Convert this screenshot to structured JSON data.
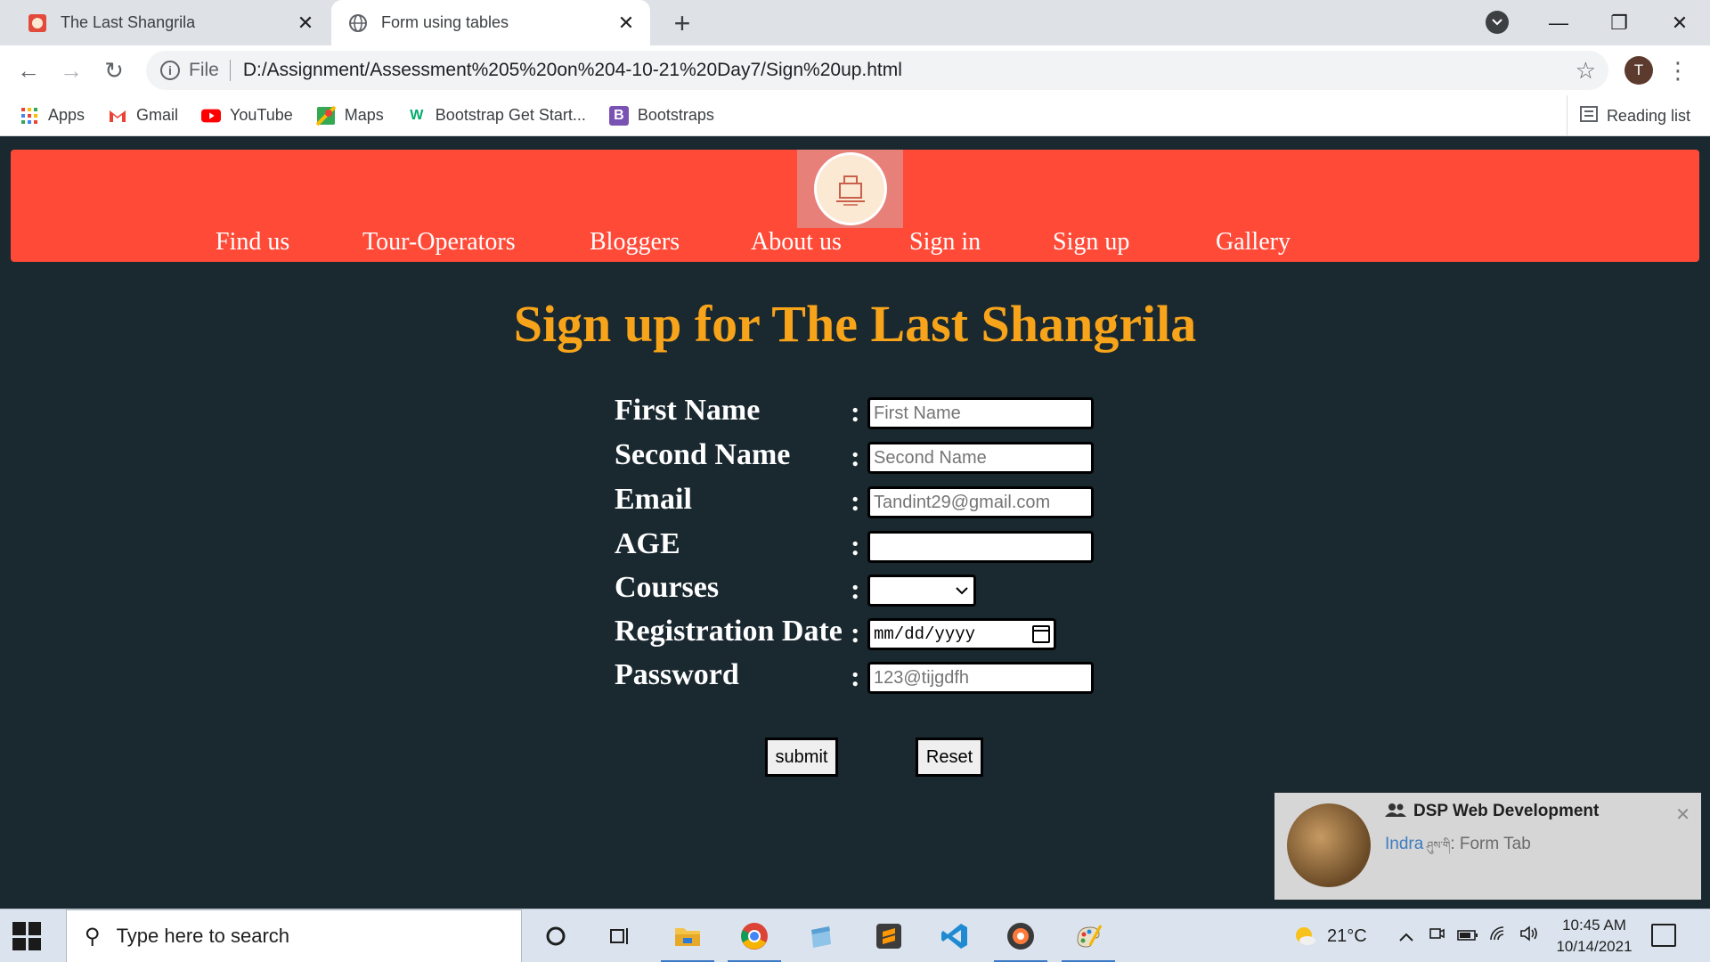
{
  "browser": {
    "tabs": [
      {
        "title": "The Last Shangrila",
        "active": false
      },
      {
        "title": "Form using tables",
        "active": true
      }
    ],
    "address": {
      "scheme": "File",
      "url": "D:/Assignment/Assessment%205%20on%204-10-21%20Day7/Sign%20up.html"
    },
    "profile_initial": "T",
    "bookmarks": [
      {
        "label": "Apps",
        "icon": "apps-grid-icon"
      },
      {
        "label": "Gmail",
        "icon": "gmail-icon"
      },
      {
        "label": "YouTube",
        "icon": "youtube-icon"
      },
      {
        "label": "Maps",
        "icon": "maps-icon"
      },
      {
        "label": "Bootstrap Get Start...",
        "icon": "w3schools-icon"
      },
      {
        "label": "Bootstraps",
        "icon": "bootstrap-icon"
      }
    ],
    "reading_list": "Reading list"
  },
  "page": {
    "nav": [
      "Find us",
      "Tour-Operators",
      "Bloggers",
      "About us",
      "Sign in",
      "Sign up",
      "Gallery"
    ],
    "title": "Sign up for The Last Shangrila",
    "form": {
      "first_name": {
        "label": "First Name",
        "placeholder": "First Name"
      },
      "second_name": {
        "label": "Second Name",
        "placeholder": "Second Name"
      },
      "email": {
        "label": "Email",
        "placeholder": "Tandint29@gmail.com"
      },
      "age": {
        "label": "AGE"
      },
      "courses": {
        "label": "Courses"
      },
      "registration_date": {
        "label": "Registration Date",
        "placeholder": "mm/dd/yyyy"
      },
      "password": {
        "label": "Password",
        "placeholder": "123@tijgdfh"
      },
      "colon": ":",
      "submit_label": "submit",
      "reset_label": "Reset"
    }
  },
  "notification": {
    "group": "DSP Web Development",
    "sender": "Indra",
    "sender_suffix": " ཤུས་གི",
    "message": ": Form Tab"
  },
  "taskbar": {
    "search_placeholder": "Type here to search",
    "weather": "21°C",
    "time": "10:45 AM",
    "date": "10/14/2021"
  },
  "colors": {
    "header_red": "#ff4a38",
    "page_bg": "#1a2830",
    "title_orange": "#f7a41a"
  }
}
